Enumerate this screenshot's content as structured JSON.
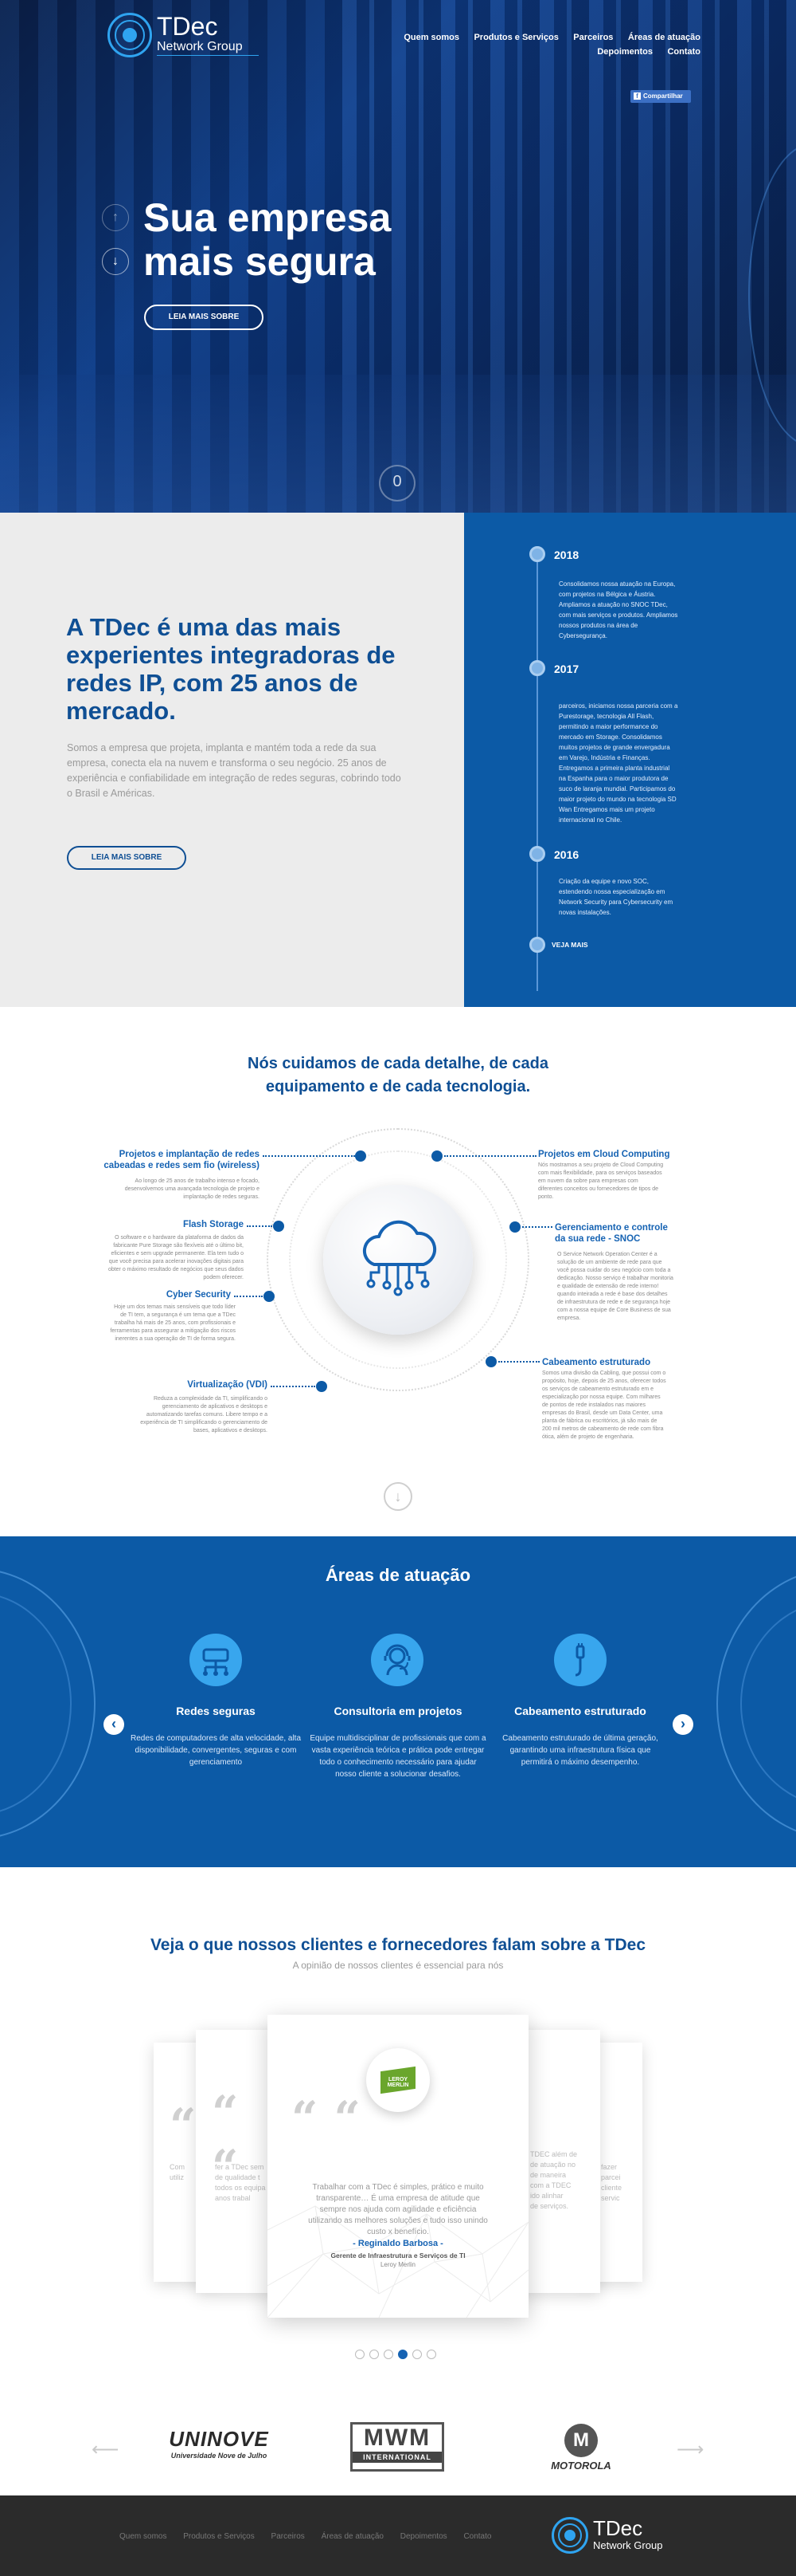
{
  "brand": {
    "name": "TDec",
    "sub": "Network Group"
  },
  "nav": [
    "Quem somos",
    "Produtos e Serviços",
    "Parceiros",
    "Áreas de atuação",
    "Depoimentos",
    "Contato"
  ],
  "share": {
    "label": "Compartilhar",
    "icon": "facebook-icon"
  },
  "hero": {
    "title_line1": "Sua empresa",
    "title_line2": "mais segura",
    "button": "LEIA MAIS SOBRE",
    "scroll_label": "0"
  },
  "intro": {
    "title": "A TDec é uma das mais experientes integradoras de redes IP, com 25 anos de mercado.",
    "text": "Somos a empresa que projeta, implanta e mantém toda a rede da sua empresa, conecta ela na nuvem e transforma o seu negócio. 25 anos de experiência e confiabilidade em integração de redes seguras, cobrindo todo o Brasil e Américas.",
    "button": "LEIA MAIS SOBRE"
  },
  "timeline": [
    {
      "year": "2018",
      "text": "Consolidamos nossa atuação na Europa, com projetos na Bélgica e Áustria. Ampliamos a atuação no SNOC TDec, com mais serviços e produtos. Ampliamos nossos produtos na área de Cybersegurança."
    },
    {
      "year": "2017",
      "text": "parceiros, iniciamos nossa parceria com a Purestorage, tecnologia All Flash, permitindo a maior performance do mercado em Storage. Consolidamos muitos projetos de grande envergadura em Varejo, Indústria e Finanças. Entregamos a primeira planta industrial na Espanha para o maior produtora de suco de laranja mundial. Participamos do maior projeto do mundo na tecnologia SD Wan Entregamos mais um projeto internacional no Chile."
    },
    {
      "year": "2016",
      "text": "Criação da equipe e novo SOC, estendendo nossa especialização em Network Security para Cybersecurity em novas instalações."
    }
  ],
  "timeline_more": "VEJA MAIS",
  "services": {
    "title_line1": "Nós cuidamos de cada detalhe, de cada",
    "title_line2": "equipamento e de cada tecnologia.",
    "items": [
      {
        "title_line1": "Projetos e implantação de redes",
        "title_line2": "cabeadas e redes sem fio (wireless)",
        "text": "Ao longo de 25 anos de trabalho intenso e focado, desenvolvemos uma avançada tecnologia de projeto e implantação de redes seguras."
      },
      {
        "title_line1": "Flash Storage",
        "title_line2": "",
        "text": "O software e o hardware da plataforma de dados da fabricante Pure Storage são flexíveis até o último bit, eficientes e sem upgrade permanente. Ela tem tudo o que você precisa para acelerar inovações digitais para obter o máximo resultado de negócios que seus dados podem oferecer."
      },
      {
        "title_line1": "Cyber Security",
        "title_line2": "",
        "text": "Hoje um dos temas mais sensíveis que todo líder de TI tem, a segurança é um tema que a TDec trabalha há mais de 25 anos, com profissionais e ferramentas para assegurar a mitigação dos riscos inerentes a sua operação de TI de forma segura."
      },
      {
        "title_line1": "Virtualização (VDI)",
        "title_line2": "",
        "text": "Reduza a complexidade da TI, simplificando o gerenciamento de aplicativos e desktops e automatizando tarefas comuns. Libere tempo e a experiência de TI simplificando o gerenciamento de bases, aplicativos e desktops."
      },
      {
        "title_line1": "Projetos em Cloud Computing",
        "title_line2": "",
        "text": "Nós mostramos a seu projeto de Cloud Computing com mais flexibilidade, para os serviços baseados em nuvem da sobre para empresas com diferentes conceitos ou fornecedores de tipos de ponto."
      },
      {
        "title_line1": "Gerenciamento e controle",
        "title_line2": "da sua rede - SNOC",
        "text": "O Service Network Operation Center é a solução de um ambiente de rede para que você possa cuidar do seu negócio com toda a dedicação. Nosso serviço é trabalhar monitoria e qualidade de extensão de rede interno! quando inteirada a rede é base dos detalhes de infraestrutura de rede e de segurança hoje com a nossa equipe de Core Business de sua empresa."
      },
      {
        "title_line1": "Cabeamento estruturado",
        "title_line2": "",
        "text": "Somos uma divisão da Cabling, que possui com o propósito, hoje, depois de 25 anos, oferecer todos os serviços de cabeamento estruturado em e especialização por nossa equipe. Com milhares de pontos de rede instalados nas maiores empresas do Brasil, desde um Data Center, uma planta de fábrica ou escritórios, já são mais de 200 mil metros de cabeamento de rede com fibra ótica, além de projeto de engenharia."
      }
    ]
  },
  "areas": {
    "title": "Áreas de atuação",
    "items": [
      {
        "title": "Redes seguras",
        "text": "Redes de computadores de alta velocidade, alta disponibilidade, convergentes, seguras e com gerenciamento"
      },
      {
        "title": "Consultoria em projetos",
        "text": "Equipe multidisciplinar de profissionais que com a vasta experiência teórica e prática pode entregar todo o conhecimento necessário para ajudar nosso cliente a solucionar desafios."
      },
      {
        "title": "Cabeamento estruturado",
        "text": "Cabeamento estruturado de última geração, garantindo uma infraestrutura física que permitirá o máximo desempenho."
      }
    ]
  },
  "testimonials": {
    "title": "Veja o que nossos clientes e fornecedores falam sobre a TDec",
    "subtitle": "A opinião de nossos clientes é essencial para nós",
    "logo_text": "LEROY MERLIN",
    "quote": "Trabalhar com a TDec é simples, prático e muito transparente… É uma empresa de atitude que sempre nos ajuda com agilidade e eficiência utilizando as melhores soluções e tudo isso unindo custo x benefício.",
    "author": "- Reginaldo Barbosa -",
    "role": "Gerente de Infraestrutura e Serviços de TI",
    "company": "Leroy Merlin",
    "left_fragments": [
      "Com",
      "utiliz"
    ],
    "left2_fragments": [
      "fer a TDec sem",
      "de qualidade t",
      "todos os equipa",
      "anos trabal"
    ],
    "right_fragments": [
      "TDEC além de",
      "de atuação no",
      "de maneira",
      "com a TDEC",
      "ido alinhar",
      "de serviços."
    ],
    "right2_fragments": [
      "fazer",
      "parcei",
      "cliente",
      "servic"
    ]
  },
  "partners": [
    "UNINOVE",
    "Universidade Nove de Julho",
    "MWM",
    "INTERNATIONAL",
    "MOTOROLA"
  ],
  "footer": {
    "nav": [
      "Quem somos",
      "Produtos e Serviços",
      "Parceiros",
      "Áreas de atuação",
      "Depoimentos",
      "Contato"
    ]
  }
}
